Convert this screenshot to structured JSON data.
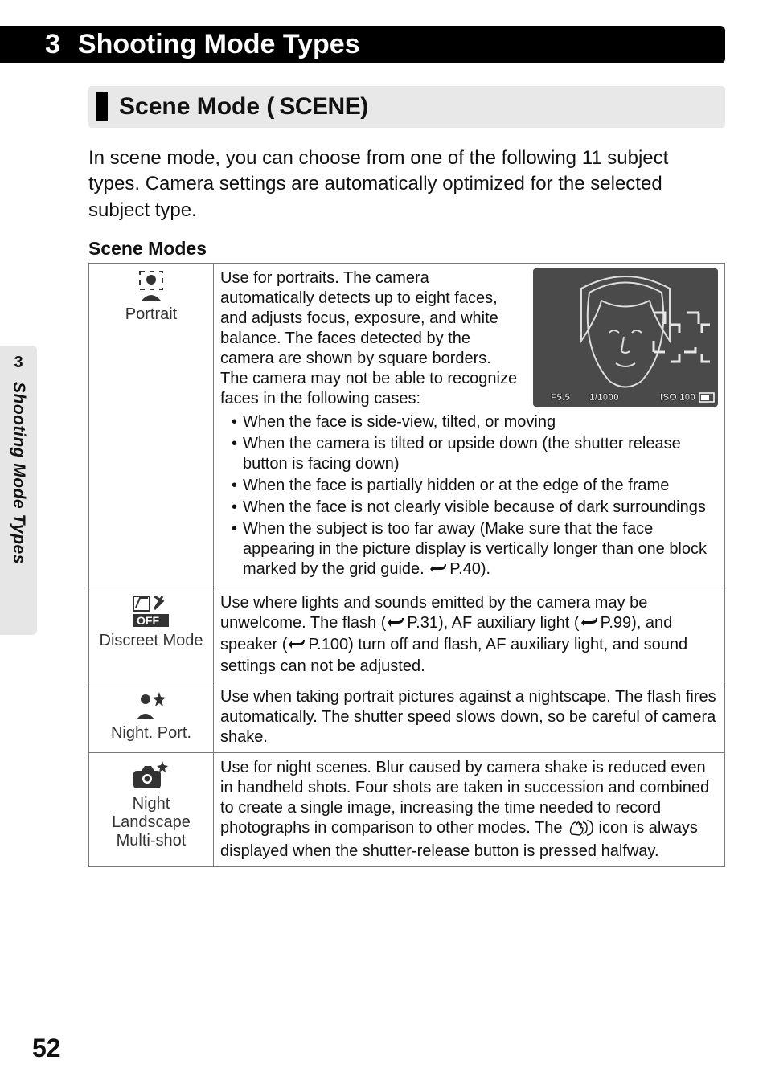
{
  "chapter": {
    "num": "3",
    "title": "Shooting Mode Types"
  },
  "side_tab": {
    "num": "3",
    "label": "Shooting Mode Types"
  },
  "section": {
    "title": "Scene Mode (",
    "code": "SCENE",
    "close": ")"
  },
  "intro": "In scene mode, you can choose from one of the following 11 subject types. Camera settings are automatically optimized for the selected subject type.",
  "sub_head": "Scene Modes",
  "thumb": {
    "f": "F5.5",
    "sh": "1/1000",
    "iso": "ISO 100"
  },
  "rows": {
    "portrait": {
      "label": "Portrait",
      "p1": "Use for portraits. The camera automatically detects up to eight faces, and adjusts focus, exposure, and white balance. The faces detected by the camera are shown by square borders.",
      "p2": "The camera may not be able to recognize faces in the following cases:",
      "b1": "When the face is side-view, tilted, or moving",
      "b2": "When the camera is tilted or upside down (the shutter release button is facing down)",
      "b3": "When the face is partially hidden or at the edge of the frame",
      "b4": "When the face is not clearly visible because of dark surroundings",
      "b5a": "When the subject is too far away (Make sure that the face appearing in the picture display is vertically longer than one block marked by the grid guide. ",
      "b5b": "P.40)."
    },
    "discreet": {
      "label": "Discreet Mode",
      "t1": "Use where lights and sounds emitted by the camera may be unwelcome. The flash (",
      "r1": "P.31), AF auxiliary light (",
      "r2": "P.99), and speaker (",
      "r3": "P.100) turn off and flash, AF auxiliary light, and sound settings can not be adjusted."
    },
    "nightport": {
      "label": "Night. Port.",
      "t": "Use when taking portrait pictures against a nightscape. The flash fires automatically. The shutter speed slows down, so be careful of camera shake."
    },
    "nightland": {
      "label1": "Night",
      "label2": "Landscape",
      "label3": "Multi-shot",
      "t1": "Use for night scenes. Blur caused by camera shake is reduced even in handheld shots. Four shots are taken in succession and combined to create a single image, increasing the time needed to record photographs in comparison to other modes. The ",
      "t2": " icon is always displayed when the shutter-release button is pressed halfway."
    }
  },
  "page_num": "52"
}
